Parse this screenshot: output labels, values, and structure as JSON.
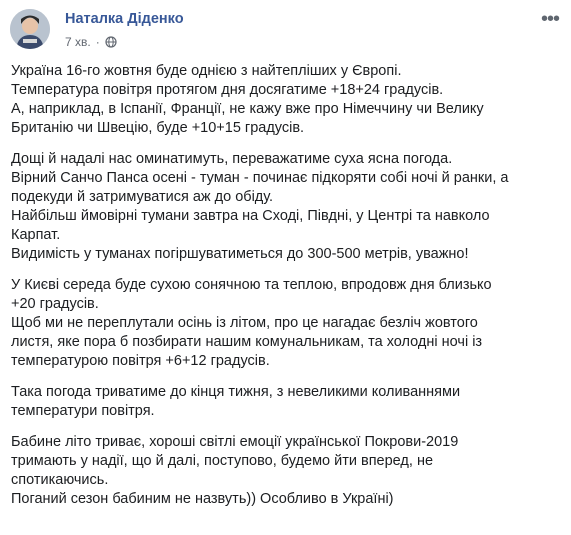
{
  "author": {
    "name": "Наталка Діденко"
  },
  "meta": {
    "time": "7 хв.",
    "separator": "·",
    "privacy_icon": "globe-icon"
  },
  "more_icon": "more-options-icon",
  "paragraphs": [
    [
      "Україна 16-го жовтня буде однією з найтепліших у Європі.",
      "Температура повітря протягом дня досягатиме +18+24 градусів.",
      "А, наприклад, в Іспанії, Франції, не кажу вже про Німеччину чи Велику",
      "Британію чи Швецію, буде +10+15 градусів."
    ],
    [
      "Дощі й надалі нас оминатимуть, переважатиме суха ясна погода.",
      "Вірний Санчо Панса осені - туман - починає підкоряти собі ночі й ранки, а",
      "подекуди й затримуватися аж до обіду.",
      "Найбільш ймовірні тумани завтра на Сході, Півдні, у Центрі та навколо",
      "Карпат.",
      "Видимість у туманах погіршуватиметься до 300-500 метрів, уважно!"
    ],
    [
      "У Києві середа буде сухою сонячною та теплою, впродовж дня близько",
      "+20 градусів.",
      "Щоб ми не переплутали осінь із літом, про це нагадає безліч жовтого",
      "листя, яке пора б позбирати нашим комунальникам, та холодні ночі із",
      "температурою повітря +6+12 градусів."
    ],
    [
      "Така погода триватиме до кінця тижня, з невеликими коливаннями",
      "температури повітря."
    ],
    [
      "Бабине літо триває, хороші світлі емоції української Покрови-2019",
      "тримають у надії, що й далі, поступово, будемо йти вперед, не",
      "спотикаючись.",
      "Поганий сезон бабиним не назвуть)) Особливо в Україні)"
    ]
  ]
}
